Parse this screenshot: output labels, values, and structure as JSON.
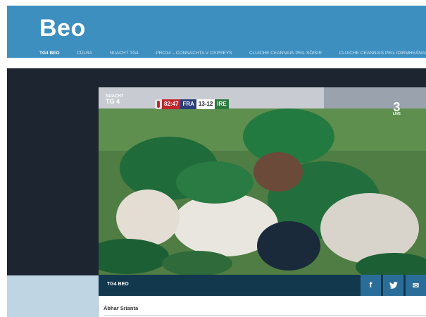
{
  "header": {
    "logo": "Beo",
    "nav": [
      {
        "label": "TG4 BEO",
        "active": true
      },
      {
        "label": "CÚLRA",
        "active": false
      },
      {
        "label": "NUACHT TG4",
        "active": false
      },
      {
        "label": "PRO14 – CONNACHTA V OSPREYS",
        "active": false
      },
      {
        "label": "CLUICHE CEANNAIS PEIL SÓISIR",
        "active": false
      },
      {
        "label": "CLUICHE CEANNAIS PEIL IDIRMHEÁNACH",
        "active": false
      }
    ]
  },
  "video": {
    "channel_logo_top": "NUACHT",
    "channel_logo_bottom": "TG 4",
    "score": {
      "time": "82:47",
      "home": "FRA",
      "points": "13-12",
      "away": "IRE"
    },
    "broadcaster_badge": "3",
    "broadcaster_sub": "LIVE"
  },
  "info_bar": {
    "label": "TG4 BEO",
    "share": [
      {
        "name": "facebook-icon",
        "glyph": "f"
      },
      {
        "name": "twitter-icon",
        "glyph": "t"
      },
      {
        "name": "email-icon",
        "glyph": "✉"
      }
    ]
  },
  "related": {
    "title": "Ábhar Srianta"
  },
  "colors": {
    "header_bg": "#3d8fc0",
    "dark_panel": "#1c2530",
    "info_bar": "#12384e",
    "share_btn": "#2b6d99"
  }
}
